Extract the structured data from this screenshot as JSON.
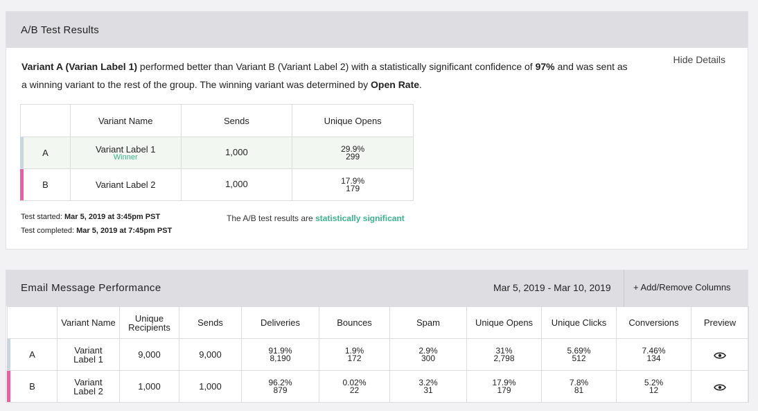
{
  "ab": {
    "title": "A/B Test Results",
    "hide_details": "Hide Details",
    "summary": {
      "winner_name": "Variant A (Varian Label 1)",
      "text1": " performed better than Variant B (Variant Label 2) with a statistically significant confidence of ",
      "confidence": "97%",
      "text2": " and was sent as a winning variant to the rest of the group. The winning variant was determined by ",
      "metric": "Open Rate",
      "text3": "."
    },
    "columns": [
      "Variant Name",
      "Sends",
      "Unique Opens"
    ],
    "rows": [
      {
        "key": "A",
        "name": "Variant Label 1",
        "tag": "Winner",
        "sends": "1,000",
        "opens_pct": "29.9%",
        "opens_count": "299"
      },
      {
        "key": "B",
        "name": "Variant Label 2",
        "tag": "",
        "sends": "1,000",
        "opens_pct": "17.9%",
        "opens_count": "179"
      }
    ],
    "started_label": "Test started: ",
    "started_value": "Mar 5, 2019 at 3:45pm PST",
    "completed_label": "Test completed: ",
    "completed_value": "Mar 5, 2019 at 7:45pm PST",
    "signif_text": "The A/B test results are ",
    "signif_value": "statistically significant"
  },
  "perf": {
    "title": "Email Message Performance",
    "date_range": "Mar 5, 2019 - Mar 10, 2019",
    "add_columns": "+ Add/Remove Columns",
    "columns": [
      "Variant Name",
      "Unique Recipients",
      "Sends",
      "Deliveries",
      "Bounces",
      "Spam",
      "Unique Opens",
      "Unique Clicks",
      "Conversions",
      "Preview"
    ],
    "rows": [
      {
        "key": "A",
        "name": "Variant Label 1",
        "recipients": "9,000",
        "sends": "9,000",
        "deliveries": [
          "91.9%",
          "8,190"
        ],
        "bounces": [
          "1.9%",
          "172"
        ],
        "spam": [
          "2.9%",
          "300"
        ],
        "opens": [
          "31%",
          "2,798"
        ],
        "clicks": [
          "5.69%",
          "512"
        ],
        "conversions": [
          "7.46%",
          "134"
        ]
      },
      {
        "key": "B",
        "name": "Variant Label 2",
        "recipients": "1,000",
        "sends": "1,000",
        "deliveries": [
          "96.2%",
          "879"
        ],
        "bounces": [
          "0.02%",
          "22"
        ],
        "spam": [
          "3.2%",
          "31"
        ],
        "opens": [
          "17.9%",
          "179"
        ],
        "clicks": [
          "7.8%",
          "81"
        ],
        "conversions": [
          "5.2%",
          "12"
        ]
      }
    ],
    "preview_icon": "eye-icon"
  },
  "colors": {
    "variant_a": "#c7d6e1",
    "variant_b": "#ea5fa0",
    "winner": "#3ab38c",
    "header_bg": "#dedee2"
  }
}
